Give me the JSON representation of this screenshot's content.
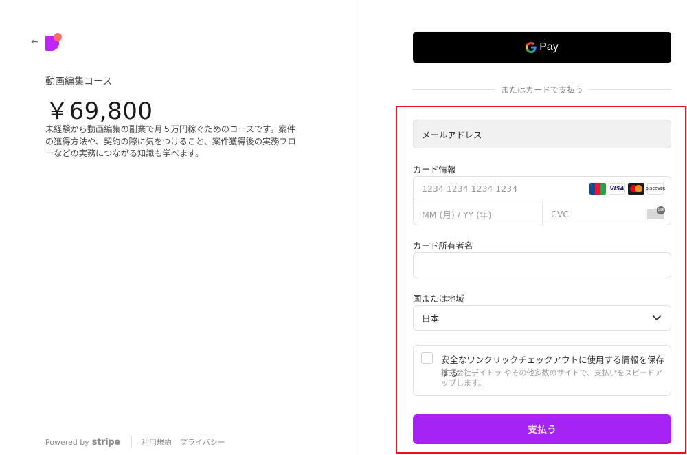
{
  "summary": {
    "back_icon": "arrow-left-icon",
    "product_name": "動画編集コース",
    "price": "￥69,800",
    "description": "未経験から動画編集の副業で月５万円稼ぐためのコースです。案件の獲得方法や、契約の際に気をつけること、案件獲得後の実務フローなどの実務につながる知識も学べます。"
  },
  "footer": {
    "powered_by": "Powered by",
    "stripe": "stripe",
    "terms": "利用規約",
    "privacy": "プライバシー"
  },
  "payment": {
    "gpay_label": "Pay",
    "or_pay_with_card": "またはカードで支払う",
    "email_label": "メールアドレス",
    "card_info_label": "カード情報",
    "card_number_placeholder": "1234 1234 1234 1234",
    "card_brands": [
      "JCB",
      "VISA",
      "mastercard",
      "DISCOVER"
    ],
    "expiry_placeholder": "MM (月) / YY (年)",
    "cvc_placeholder": "CVC",
    "cvc_badge": "135",
    "cardholder_label": "カード所有者名",
    "cardholder_value": "",
    "country_label": "国または地域",
    "country_value": "日本",
    "save_info_title": "安全なワンクリックチェックアウトに使用する情報を保存する",
    "save_info_desc": "株式会社デイトラ やその他多数のサイトで、支払いをスピードアップします。",
    "save_checked": false,
    "pay_button": "支払う"
  },
  "colors": {
    "accent": "#a524f4",
    "highlight": "#e8121f",
    "gpay_bg": "#000000"
  }
}
